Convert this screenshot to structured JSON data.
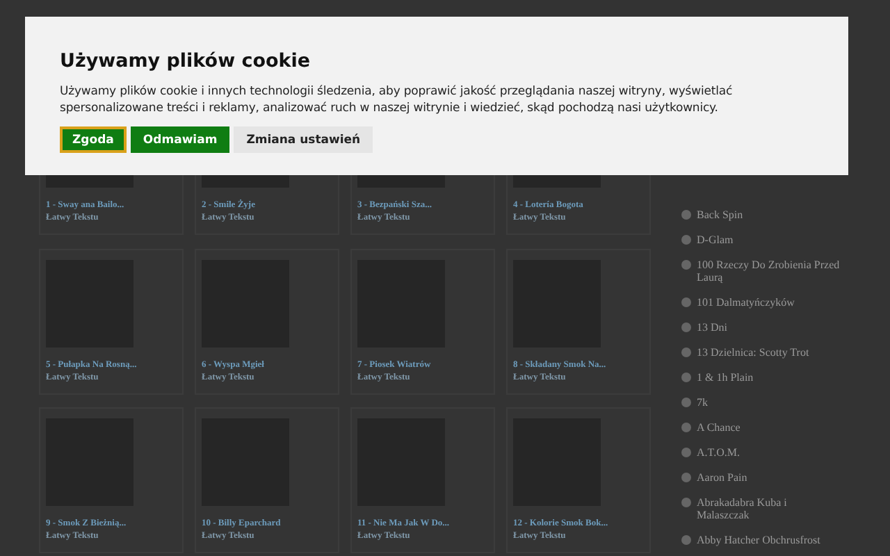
{
  "cookie_dialog": {
    "title": "Używamy plików cookie",
    "text": "Używamy plików cookie i innych technologii śledzenia, aby poprawić jakość przeglądania naszej witryny, wyświetlać spersonalizowane treści i reklamy, analizować ruch w naszej witrynie i wiedzieć, skąd pochodzą nasi użytkownicy.",
    "buttons": [
      {
        "label": "Zgoda",
        "kind": "accept",
        "focused": true
      },
      {
        "label": "Odmawiam",
        "kind": "accept",
        "focused": false
      },
      {
        "label": "Zmiana ustawień",
        "kind": "secondary",
        "focused": false
      }
    ]
  },
  "cards": [
    {
      "title": "1 - Sway ana Bailo...",
      "subtitle": "Łatwy Tekstu"
    },
    {
      "title": "2 - Smile Żyje",
      "subtitle": "Łatwy Tekstu"
    },
    {
      "title": "3 - Bezpański Sza...",
      "subtitle": "Łatwy Tekstu"
    },
    {
      "title": "4 - Lotería Bogota",
      "subtitle": "Łatwy Tekstu"
    },
    {
      "title": "5 - Pułapka Na Rosną...",
      "subtitle": "Łatwy Tekstu"
    },
    {
      "title": "6 - Wyspa Mgieł",
      "subtitle": "Łatwy Tekstu"
    },
    {
      "title": "7 - Piosek Wiatrów",
      "subtitle": "Łatwy Tekstu"
    },
    {
      "title": "8 - Składany Smok Na...",
      "subtitle": "Łatwy Tekstu"
    },
    {
      "title": "9 - Smok Z Bieżnią...",
      "subtitle": "Łatwy Tekstu"
    },
    {
      "title": "10 - Billy Eparchard",
      "subtitle": "Łatwy Tekstu"
    },
    {
      "title": "11 - Nie Ma Jak W Do...",
      "subtitle": "Łatwy Tekstu"
    },
    {
      "title": "12 - Kolorie Smok Bok...",
      "subtitle": "Łatwy Tekstu"
    }
  ],
  "sidebar": {
    "items": [
      "Back Spin",
      "D-Glam",
      "100 Rzeczy Do Zrobienia Przed Laurą",
      "101 Dalmatyńczyków",
      "13 Dni",
      "13 Dzielnica: Scotty Trot",
      "1 & 1h Plain",
      "7k",
      "A Chance",
      "A.T.O.M.",
      "Aaron Pain",
      "Abrakadabra Kuba i Malaszczak",
      "Abby Hatcher Obchrusfrost"
    ]
  }
}
